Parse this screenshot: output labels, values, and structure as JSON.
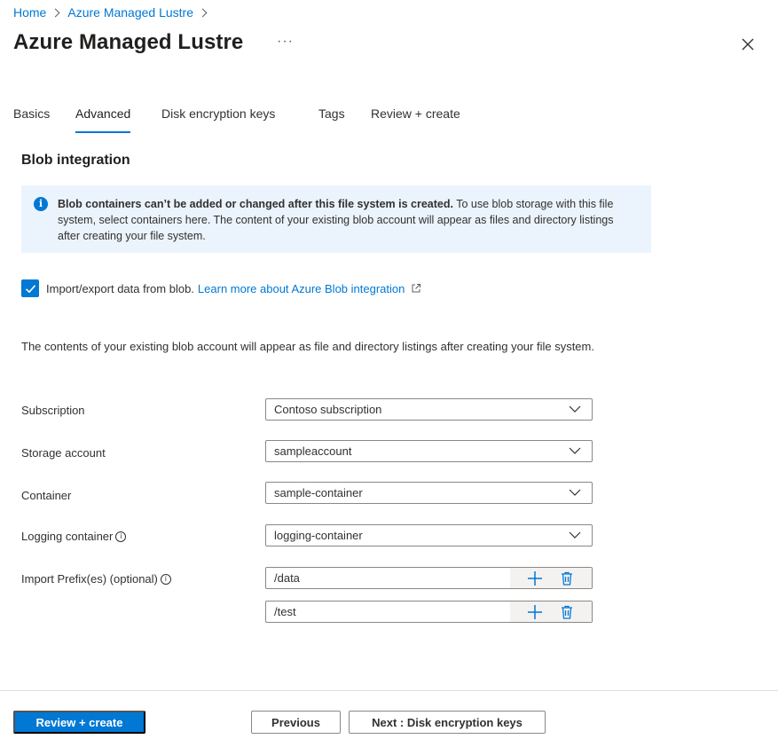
{
  "breadcrumb": {
    "home": "Home",
    "parent": "Azure Managed Lustre"
  },
  "header": {
    "title": "Azure Managed Lustre",
    "more": "···"
  },
  "tabs": [
    "Basics",
    "Advanced",
    "Disk encryption keys",
    "Tags",
    "Review + create"
  ],
  "section": {
    "title": "Blob integration"
  },
  "info": {
    "icon": "info-icon",
    "bold": "Blob containers can’t be added or changed after this file system is created.",
    "text": " To use blob storage with this file system, select containers here. The content of your existing blob account will appear as files and directory listings after creating your file system."
  },
  "checkbox": {
    "checked": true,
    "label": "Import/export data from blob.",
    "link": "Learn more about Azure Blob integration"
  },
  "description": "The contents of your existing blob account will appear as file and directory listings after creating your file system.",
  "fields": {
    "subscription": {
      "label": "Subscription",
      "value": "Contoso subscription"
    },
    "storage": {
      "label": "Storage account",
      "value": "sampleaccount"
    },
    "container": {
      "label": "Container",
      "value": "sample-container"
    },
    "logging": {
      "label": "Logging container",
      "value": "logging-container"
    },
    "prefix": {
      "label": "Import Prefix(es) (optional)",
      "values": [
        "/data",
        "/test"
      ]
    }
  },
  "footer": {
    "review": "Review + create",
    "previous": "Previous",
    "next": "Next : Disk encryption keys"
  },
  "colors": {
    "accent": "#0078d4",
    "info_bg": "#ebf3fc"
  }
}
